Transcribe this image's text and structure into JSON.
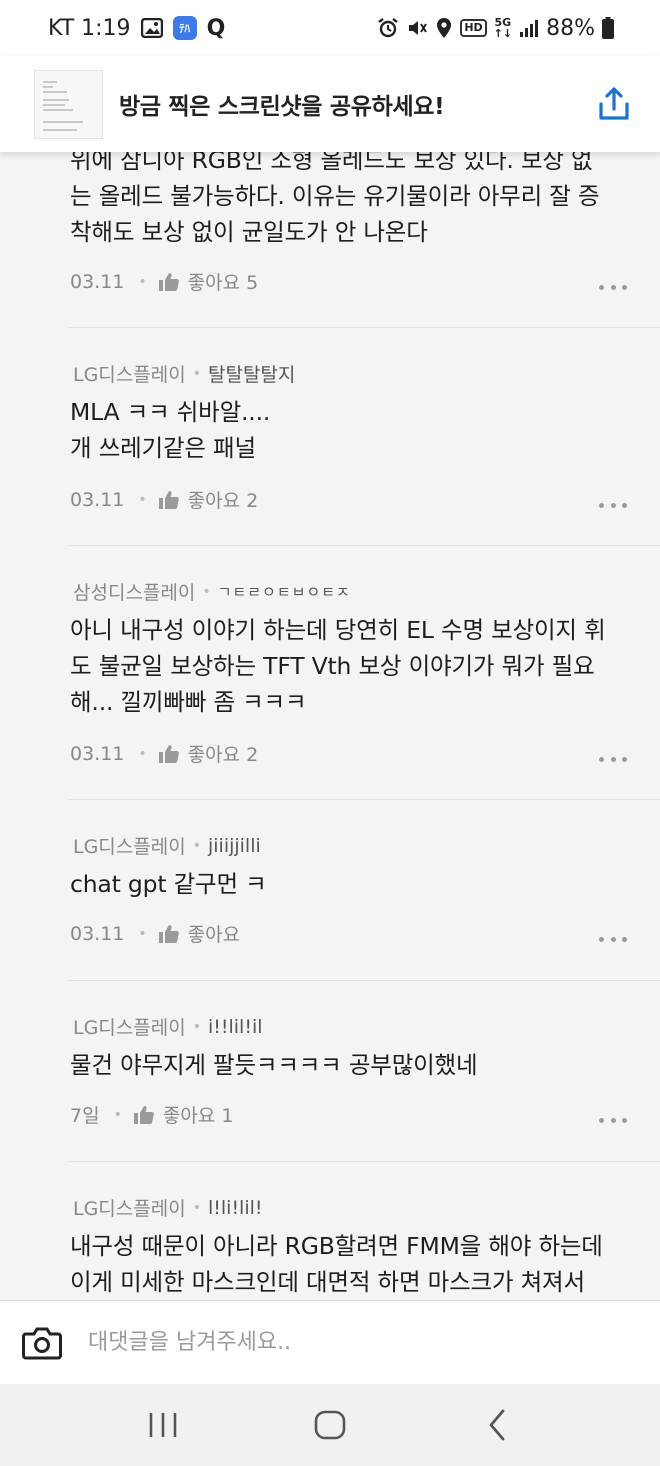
{
  "status_bar": {
    "carrier_time": "KT 1:19",
    "app_icons": [
      "gallery-icon",
      "app-icon",
      "q-icon"
    ],
    "app_badge": "ﾃﾊ",
    "q": "Q",
    "hd": "HD",
    "net_top": "5G",
    "net_bottom": "↑↓",
    "battery": "88%"
  },
  "share_banner": {
    "title": "방금 찍은 스크린샷을 공유하세요!"
  },
  "comments": [
    {
      "company": "",
      "nickname": "",
      "body": [
        "위에 삼니아 RGB인 소형 올레드도 보상 있다. 보상 없",
        "는 올레드 불가능하다. 이유는 유기물이라 아무리 잘 증",
        "착해도 보상 없이 균일도가 안 나온다"
      ],
      "date": "03.11",
      "likes": "좋아요 5"
    },
    {
      "company": "LG디스플레이",
      "nickname": "탈탈탈탈지",
      "body": [
        "MLA ㅋㅋ 쉬바알....",
        "개 쓰레기같은 패널"
      ],
      "date": "03.11",
      "likes": "좋아요 2"
    },
    {
      "company": "삼성디스플레이",
      "nickname": "ㄱㅌㄹㅇㅌㅂㅇㅌㅈ",
      "body": [
        "아니 내구성 이야기 하는데 당연히 EL 수명 보상이지 휘",
        "도 불균일 보상하는 TFT Vth 보상 이야기가 뭐가 필요",
        "해... 낄끼빠빠 좀 ㅋㅋㅋ"
      ],
      "date": "03.11",
      "likes": "좋아요 2"
    },
    {
      "company": "LG디스플레이",
      "nickname": "jiiijjilli",
      "body": [
        "chat gpt 같구먼 ㅋ"
      ],
      "date": "03.11",
      "likes": "좋아요"
    },
    {
      "company": "LG디스플레이",
      "nickname": "i!!lil!il",
      "body": [
        "물건 야무지게 팔듯ㅋㅋㅋㅋ 공부많이했네"
      ],
      "date": "7일",
      "likes": "좋아요 1"
    },
    {
      "company": "LG디스플레이",
      "nickname": "l!li!lil!",
      "body": [
        "내구성 때문이 아니라 RGB할려면 FMM을 해야 하는데",
        "이게 미세한 마스크인데 대면적 하면 마스크가 쳐져서"
      ],
      "date": "",
      "likes": ""
    }
  ],
  "reply": {
    "placeholder": "대댓글을 남겨주세요.."
  },
  "colors": {
    "background": "#f4f4f5",
    "accent": "#1a73c9",
    "meta_text": "#888888"
  }
}
